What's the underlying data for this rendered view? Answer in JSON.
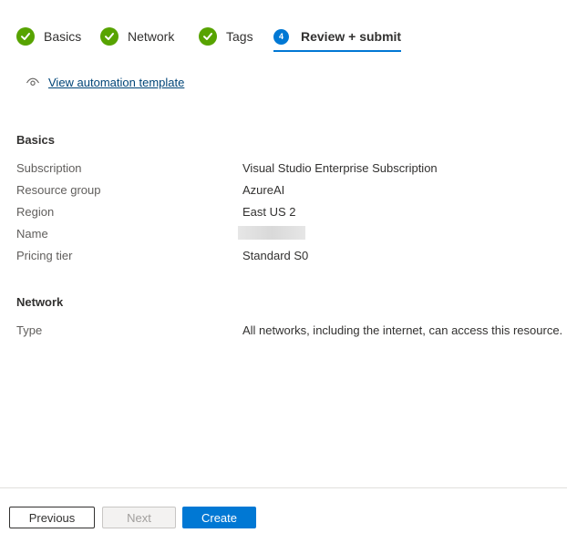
{
  "wizard": {
    "steps": [
      {
        "label": "Basics",
        "status": "complete"
      },
      {
        "label": "Network",
        "status": "complete"
      },
      {
        "label": "Tags",
        "status": "complete"
      },
      {
        "label": "Review + submit",
        "status": "active",
        "number": "4"
      }
    ]
  },
  "automation": {
    "link_text": "View automation template",
    "icon": "eye-icon"
  },
  "basics": {
    "title": "Basics",
    "rows": [
      {
        "key": "Subscription",
        "value": "Visual Studio Enterprise Subscription"
      },
      {
        "key": "Resource group",
        "value": "AzureAI"
      },
      {
        "key": "Region",
        "value": "East US 2"
      },
      {
        "key": "Name",
        "value": ""
      },
      {
        "key": "Pricing tier",
        "value": "Standard S0"
      }
    ]
  },
  "network": {
    "title": "Network",
    "rows": [
      {
        "key": "Type",
        "value": "All networks, including the internet, can access this resource."
      }
    ]
  },
  "footer": {
    "previous_label": "Previous",
    "next_label": "Next",
    "create_label": "Create"
  },
  "colors": {
    "accent": "#0078d4",
    "success": "#57a300",
    "link": "#004578"
  }
}
